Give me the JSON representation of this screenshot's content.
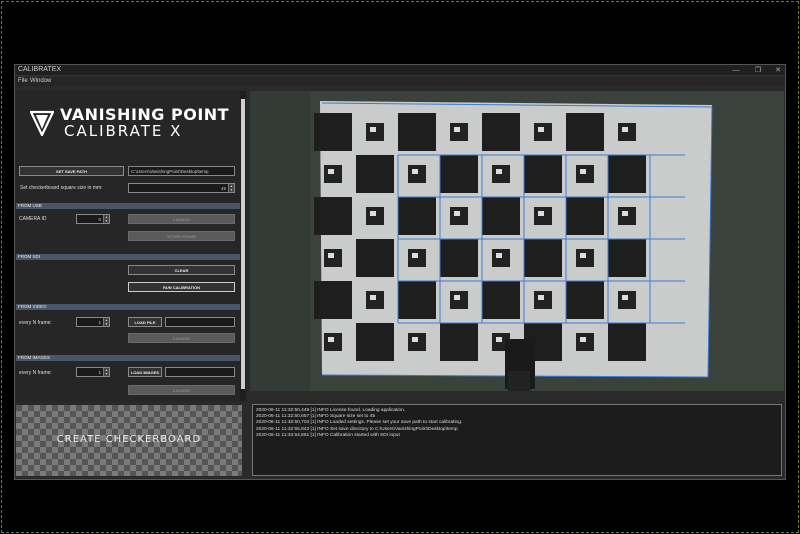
{
  "window": {
    "title": "CALIBRATEX",
    "controls": [
      "—",
      "❐",
      "✕"
    ]
  },
  "menu": [
    "File",
    "Window"
  ],
  "logo": {
    "line1": "VANISHING POINT",
    "line2": "CALIBRATE X"
  },
  "settings": {
    "set_save_path_label": "SET SAVE PATH",
    "save_path_value": "C:\\Users\\VanishingPoint\\Desktop\\temp",
    "square_size_label": "Set checkerboard square size in mm:",
    "square_size_value": "45"
  },
  "usb": {
    "header": "FROM USB",
    "camera_id_label": "CAMERA ID",
    "camera_id_value": "0",
    "launch_label": "LAUNCH",
    "store_frame_label": "STORE FRAME"
  },
  "sdi": {
    "header": "FROM SDI",
    "clear_label": "CLEAR",
    "run_calibration_label": "RUN CALIBRATION"
  },
  "video": {
    "header": "FROM VIDEO",
    "every_n_label": "every N frame:",
    "every_n_value": "1",
    "load_file_label": "LOAD FILE",
    "file_value": "",
    "launch_label": "LAUNCH"
  },
  "images": {
    "header": "FROM IMAGES",
    "every_n_label": "every N frame:",
    "every_n_value": "1",
    "load_images_label": "LOAD IMAGES",
    "images_value": "",
    "launch_label": "LAUNCH"
  },
  "create_checkerboard_label": "CREATE CHECKERBOARD",
  "log_lines": [
    "2020-06-11 11:32:50,449 [1] INFO  License found. Loading application.",
    "2020-06-11 11:32:50,657 [1] INFO  Square size set to 45",
    "2020-06-11 11:32:50,703 [1] INFO  Loaded settings. Please set your save path to start calibrating.",
    "2020-06-11 11:32:55,843 [1] INFO  Set save directory to C:\\Users\\VanishingPoint\\Desktop\\temp",
    "2020-06-11 11:34:54,851 [1] INFO  Calibration started with SDI input"
  ],
  "colors": {
    "accent_blue": "#3a7bd5",
    "section_header": "#4a5568",
    "panel_bg": "#262626"
  }
}
